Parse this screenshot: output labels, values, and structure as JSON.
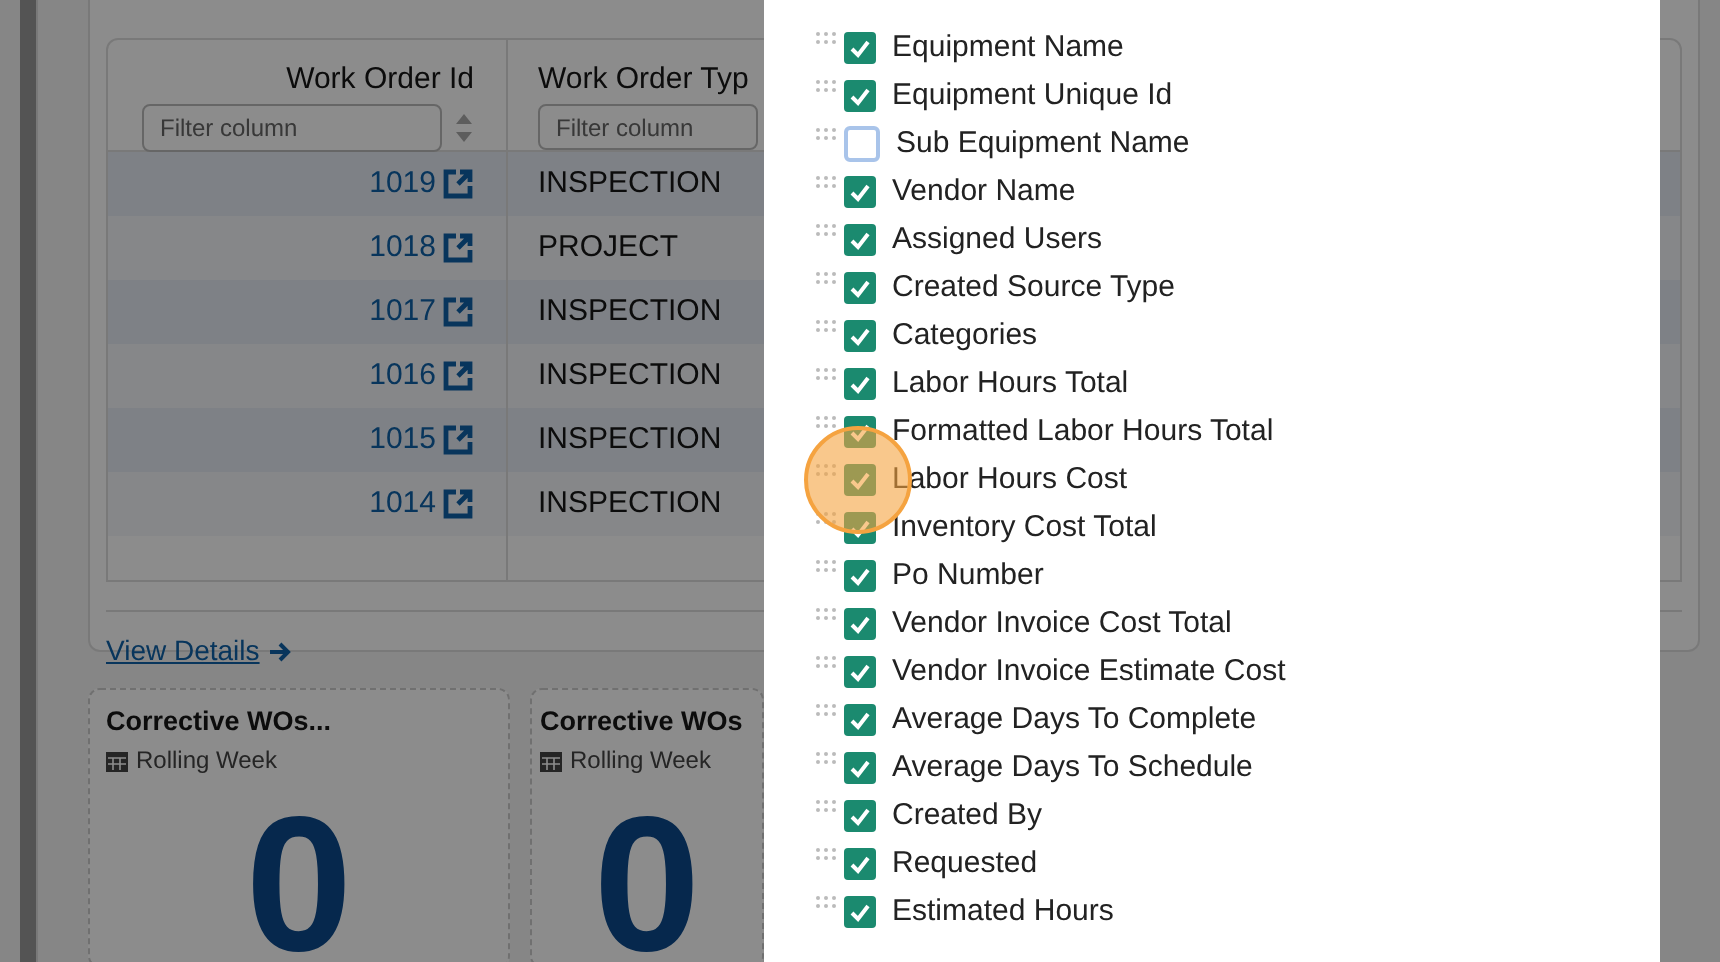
{
  "table": {
    "columns": [
      {
        "label": "Work Order Id",
        "filter_placeholder": "Filter column"
      },
      {
        "label": "Work Order Typ",
        "filter_placeholder": "Filter column"
      }
    ],
    "rows": [
      {
        "id": "1019",
        "type": "INSPECTION"
      },
      {
        "id": "1018",
        "type": "PROJECT"
      },
      {
        "id": "1017",
        "type": "INSPECTION"
      },
      {
        "id": "1016",
        "type": "INSPECTION"
      },
      {
        "id": "1015",
        "type": "INSPECTION"
      },
      {
        "id": "1014",
        "type": "INSPECTION"
      }
    ],
    "link": "View Details"
  },
  "cards": [
    {
      "title": "Corrective WOs...",
      "period": "Rolling Week",
      "value": "0"
    },
    {
      "title": "Corrective WOs",
      "period": "Rolling Week",
      "value": "0"
    }
  ],
  "column_picker": {
    "items": [
      {
        "label": "Equipment Name",
        "checked": true
      },
      {
        "label": "Equipment Unique Id",
        "checked": true
      },
      {
        "label": "Sub Equipment Name",
        "checked": false
      },
      {
        "label": "Vendor Name",
        "checked": true
      },
      {
        "label": "Assigned Users",
        "checked": true
      },
      {
        "label": "Created Source Type",
        "checked": true
      },
      {
        "label": "Categories",
        "checked": true
      },
      {
        "label": "Labor Hours Total",
        "checked": true
      },
      {
        "label": "Formatted Labor Hours Total",
        "checked": true
      },
      {
        "label": "Labor Hours Cost",
        "checked": true
      },
      {
        "label": "Inventory Cost Total",
        "checked": true
      },
      {
        "label": "Po Number",
        "checked": true
      },
      {
        "label": "Vendor Invoice Cost Total",
        "checked": true
      },
      {
        "label": "Vendor Invoice Estimate Cost",
        "checked": true
      },
      {
        "label": "Average Days To Complete",
        "checked": true
      },
      {
        "label": "Average Days To Schedule",
        "checked": true
      },
      {
        "label": "Created By",
        "checked": true
      },
      {
        "label": "Requested",
        "checked": true
      },
      {
        "label": "Estimated Hours",
        "checked": true
      }
    ]
  }
}
